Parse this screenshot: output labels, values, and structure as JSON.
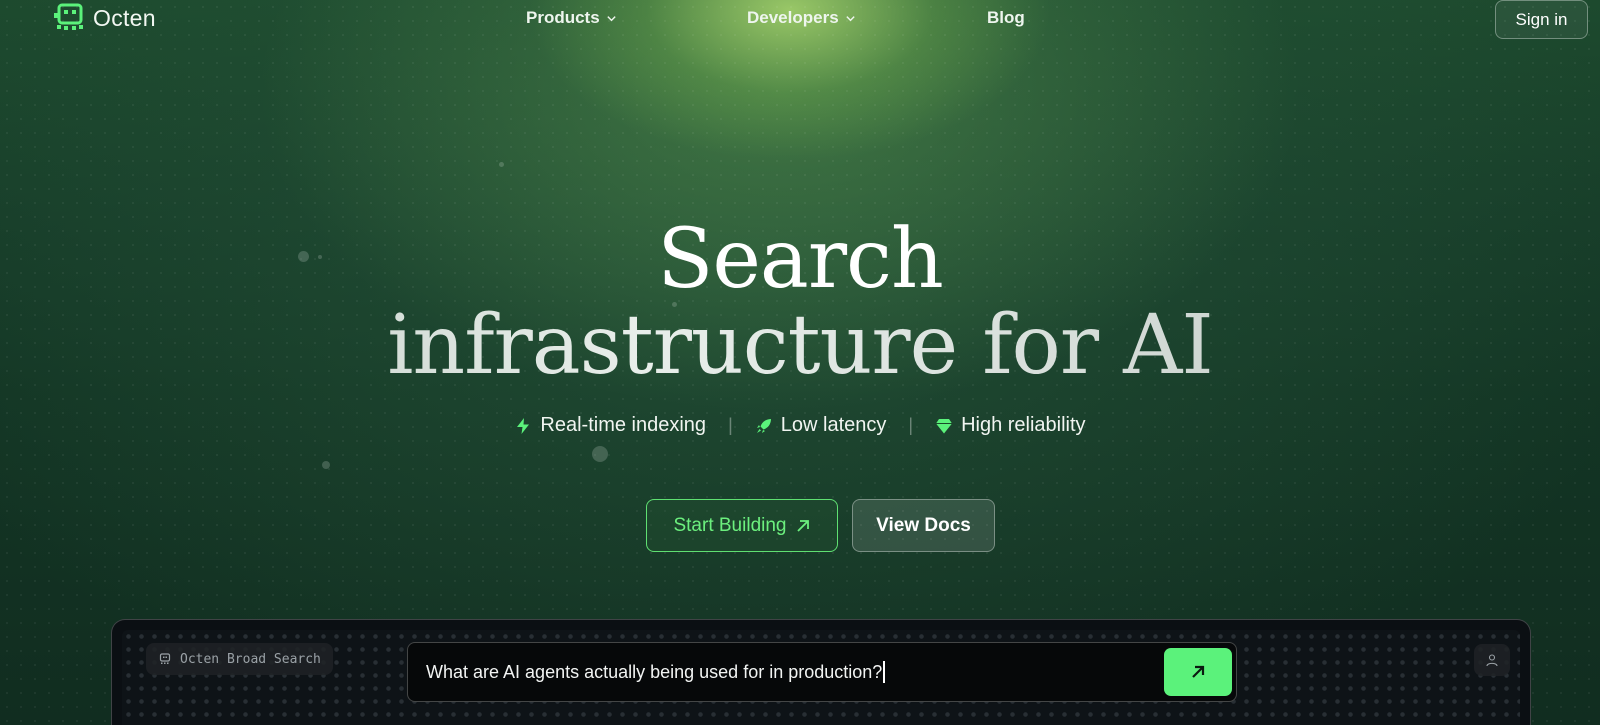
{
  "colors": {
    "accent_green": "#5bf27b",
    "background": "#133524",
    "panel": "#0b0f13"
  },
  "nav": {
    "logo_text": "Octen",
    "items": [
      {
        "label": "Products",
        "has_dropdown": true
      },
      {
        "label": "Developers",
        "has_dropdown": true
      },
      {
        "label": "Blog",
        "has_dropdown": false
      }
    ],
    "signin_label": "Sign in"
  },
  "hero": {
    "title_line1": "Search",
    "title_line2": "infrastructure for AI",
    "features": [
      {
        "label": "Real-time indexing",
        "icon": "lightning-icon"
      },
      {
        "label": "Low latency",
        "icon": "rocket-icon"
      },
      {
        "label": "High reliability",
        "icon": "gem-icon"
      }
    ],
    "separator": "|",
    "start_label": "Start Building",
    "docs_label": "View Docs"
  },
  "demo": {
    "mode_label": "Octen Broad Search",
    "query": "What are AI agents actually being used for in production?",
    "submit_icon": "arrow-up-right-icon",
    "user_icon": "user-icon"
  }
}
